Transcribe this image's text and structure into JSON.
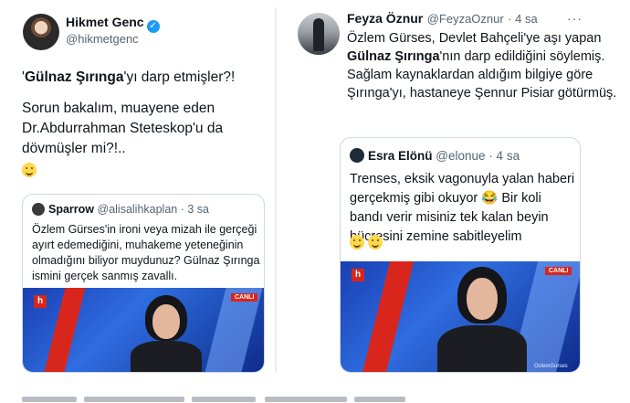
{
  "left_tweet": {
    "author_name": "Hikmet Genc",
    "author_handle": "@hikmetgenc",
    "verified_icon": "verified-badge-icon",
    "line1_prefix": "'",
    "line1_bold": "Gülnaz Şırınga",
    "line1_suffix": "'yı darp etmişler?!",
    "paragraph2": "Sorun bakalım, muayene eden Dr.Abdurrahman Steteskop'u da dövmüşler mi?!..",
    "emoji": "grinning-sweat-emoji",
    "quote": {
      "author_name": "Sparrow",
      "author_handle": "@alisalihkaplan",
      "time": "· 3 sa",
      "text": "Özlem Gürses'in ironi veya mizah ile gerçeği ayırt edemediğini, muhakeme yeteneğinin olmadığını biliyor muydunuz? Gülnaz Şırınga ismini gerçek sanmış zavallı.",
      "video_badge": "CANLI",
      "video_logo": "h"
    }
  },
  "right_tweet": {
    "author_name": "Feyza Öznur",
    "author_handle": "@FeyzaOznur",
    "time": "· 4 sa",
    "more_label": "···",
    "text_part1": "Özlem Gürses, Devlet Bahçeli'ye aşı yapan ",
    "text_bold": "Gülnaz Şırınga",
    "text_part2": "'nın darp edildiğini söylemiş. Sağlam kaynaklardan aldığım bilgiye göre Şırınga'yı, hastaneye Şennur Pisiar götürmüş.",
    "quote": {
      "author_name": "Esra Elönü",
      "author_handle": "@elonue",
      "time": "· 4 sa",
      "text": "Trenses, eksik vagonuyla yalan haberi gerçekmiş gibi okuyor 😂 Bir koli bandı verir misiniz tek kalan beyin hücresini zemine sabitleyelim",
      "emoji": "grimacing-emoji",
      "video_badge": "CANLI",
      "video_logo": "h",
      "video_watermark": "OzlemGurses"
    }
  },
  "colors": {
    "verified": "#1d9bf0",
    "text": "#0f1419",
    "secondary": "#536471",
    "border": "#cfd9de",
    "channel_red": "#d9261c",
    "studio_blue": "#1a3fb3"
  }
}
